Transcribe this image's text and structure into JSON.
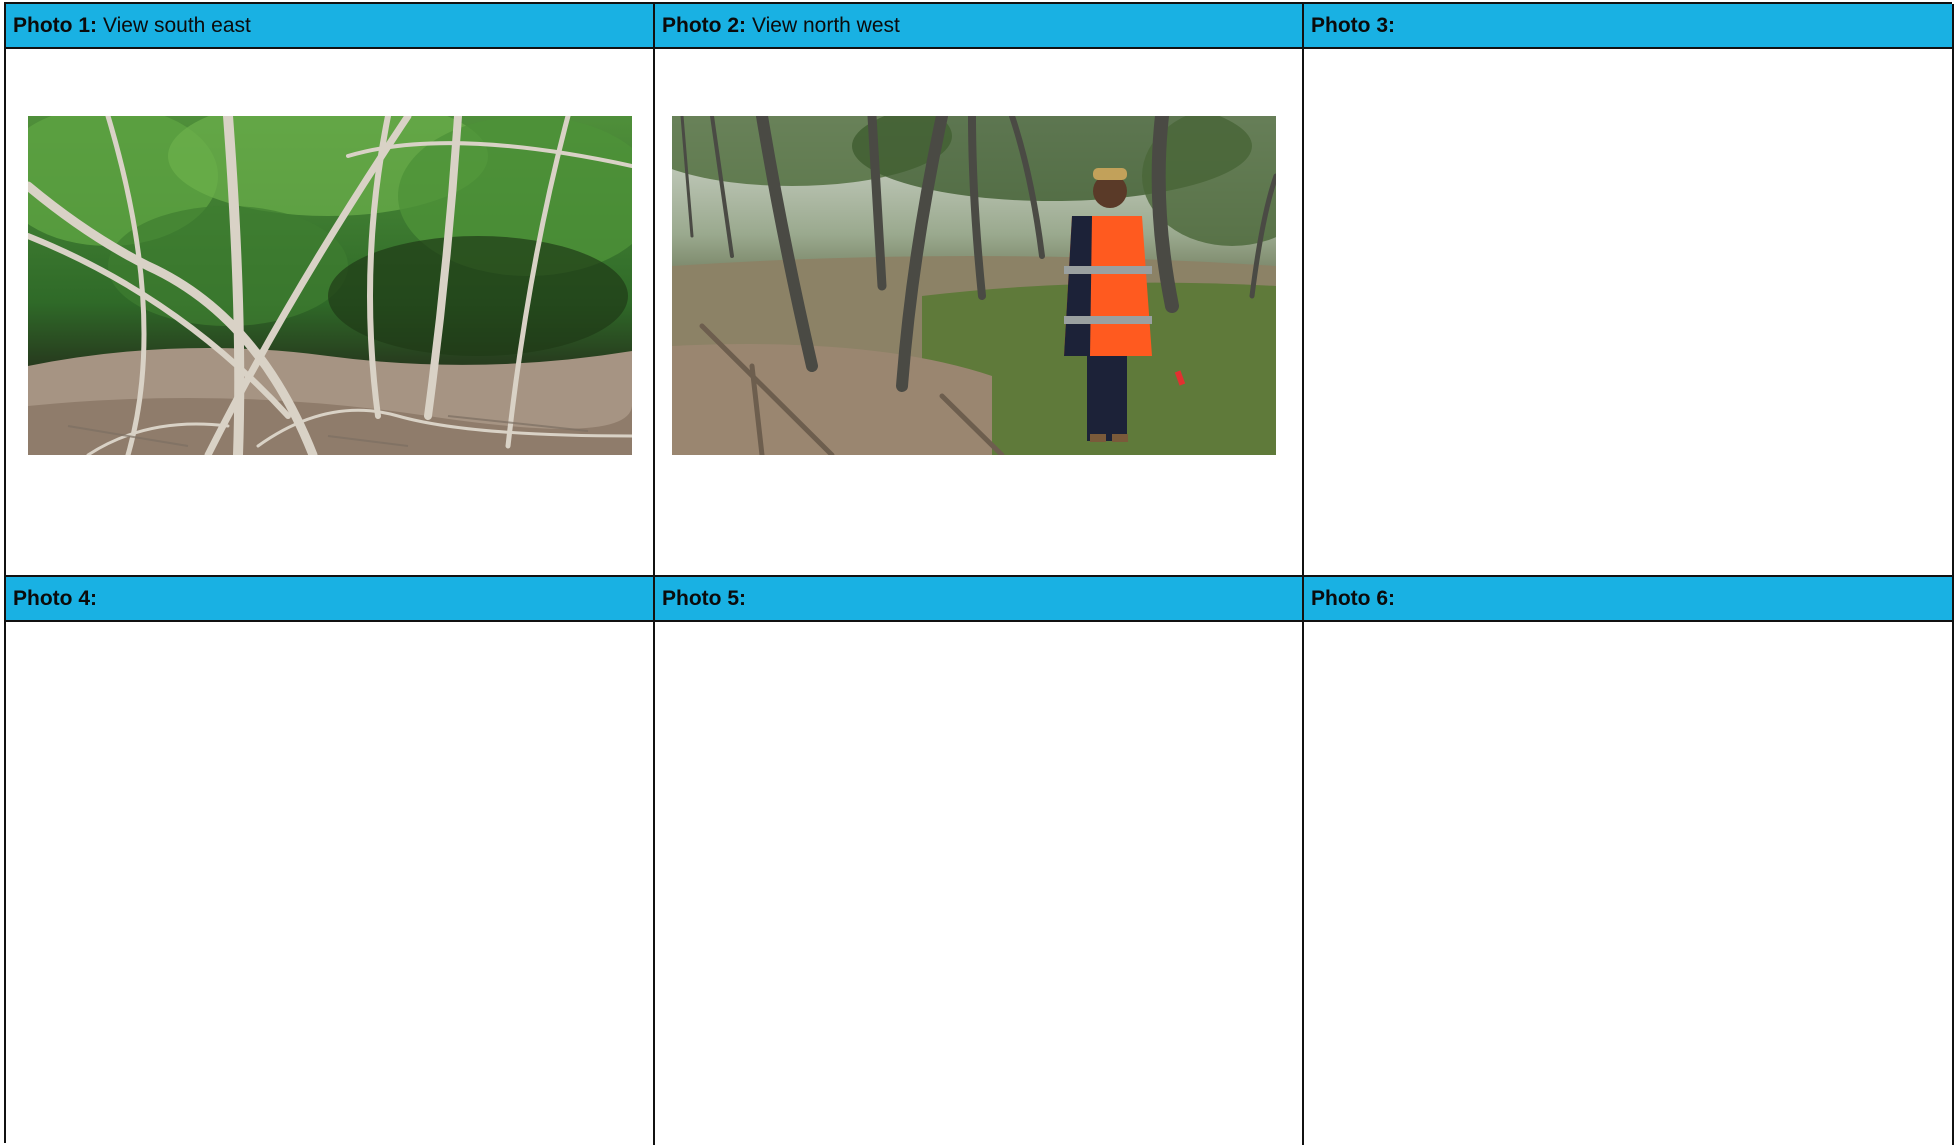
{
  "photos": [
    {
      "label": "Photo 1:",
      "caption": "View south east",
      "image": "photo-forest-trees"
    },
    {
      "label": "Photo 2:",
      "caption": "View north west",
      "image": "photo-person-in-hi-vis-jacket"
    },
    {
      "label": "Photo 3:",
      "caption": ""
    },
    {
      "label": "Photo 4:",
      "caption": ""
    },
    {
      "label": "Photo 5:",
      "caption": ""
    },
    {
      "label": "Photo 6:",
      "caption": ""
    }
  ],
  "colors": {
    "header_bg": "#19b1e3",
    "border": "#111111"
  }
}
